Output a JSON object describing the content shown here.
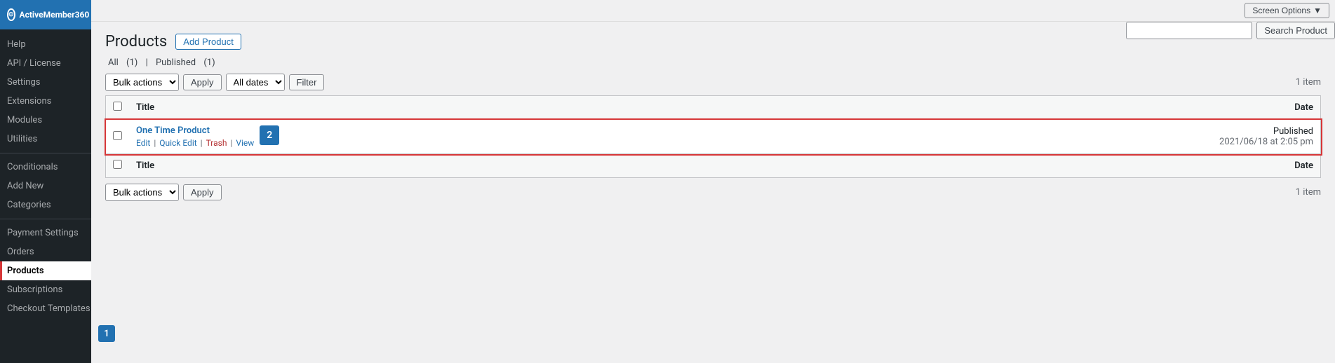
{
  "sidebar": {
    "logo": "ActiveMember360",
    "items": [
      {
        "label": "Help",
        "id": "help"
      },
      {
        "label": "API / License",
        "id": "api-license"
      },
      {
        "label": "Settings",
        "id": "settings"
      },
      {
        "label": "Extensions",
        "id": "extensions"
      },
      {
        "label": "Modules",
        "id": "modules"
      },
      {
        "label": "Utilities",
        "id": "utilities"
      },
      {
        "label": "Conditionals",
        "id": "conditionals"
      },
      {
        "label": "Add New",
        "id": "add-new"
      },
      {
        "label": "Categories",
        "id": "categories"
      },
      {
        "label": "Payment Settings",
        "id": "payment-settings"
      },
      {
        "label": "Orders",
        "id": "orders"
      },
      {
        "label": "Products",
        "id": "products",
        "active": true
      },
      {
        "label": "Subscriptions",
        "id": "subscriptions"
      },
      {
        "label": "Checkout Templates",
        "id": "checkout-templates"
      }
    ]
  },
  "topbar": {
    "screen_options_label": "Screen Options",
    "screen_options_arrow": "▼"
  },
  "page": {
    "title": "Products",
    "add_button_label": "Add Product",
    "filter_all_label": "All",
    "filter_all_count": "(1)",
    "filter_published_label": "Published",
    "filter_published_count": "(1)",
    "item_count": "1 item",
    "search_placeholder": "",
    "search_button_label": "Search Product"
  },
  "toolbar_top": {
    "bulk_actions_label": "Bulk actions",
    "apply_label": "Apply",
    "all_dates_label": "All dates",
    "filter_label": "Filter"
  },
  "toolbar_bottom": {
    "bulk_actions_label": "Bulk actions",
    "apply_label": "Apply",
    "item_count": "1 item"
  },
  "table": {
    "col_title": "Title",
    "col_date": "Date",
    "rows": [
      {
        "id": 1,
        "title": "One Time Product",
        "actions": [
          "Edit",
          "Quick Edit",
          "Trash",
          "View"
        ],
        "status": "Published",
        "date": "2021/06/18 at 2:05 pm",
        "badge": "2"
      }
    ]
  },
  "badges": {
    "sidebar_products": "1"
  }
}
